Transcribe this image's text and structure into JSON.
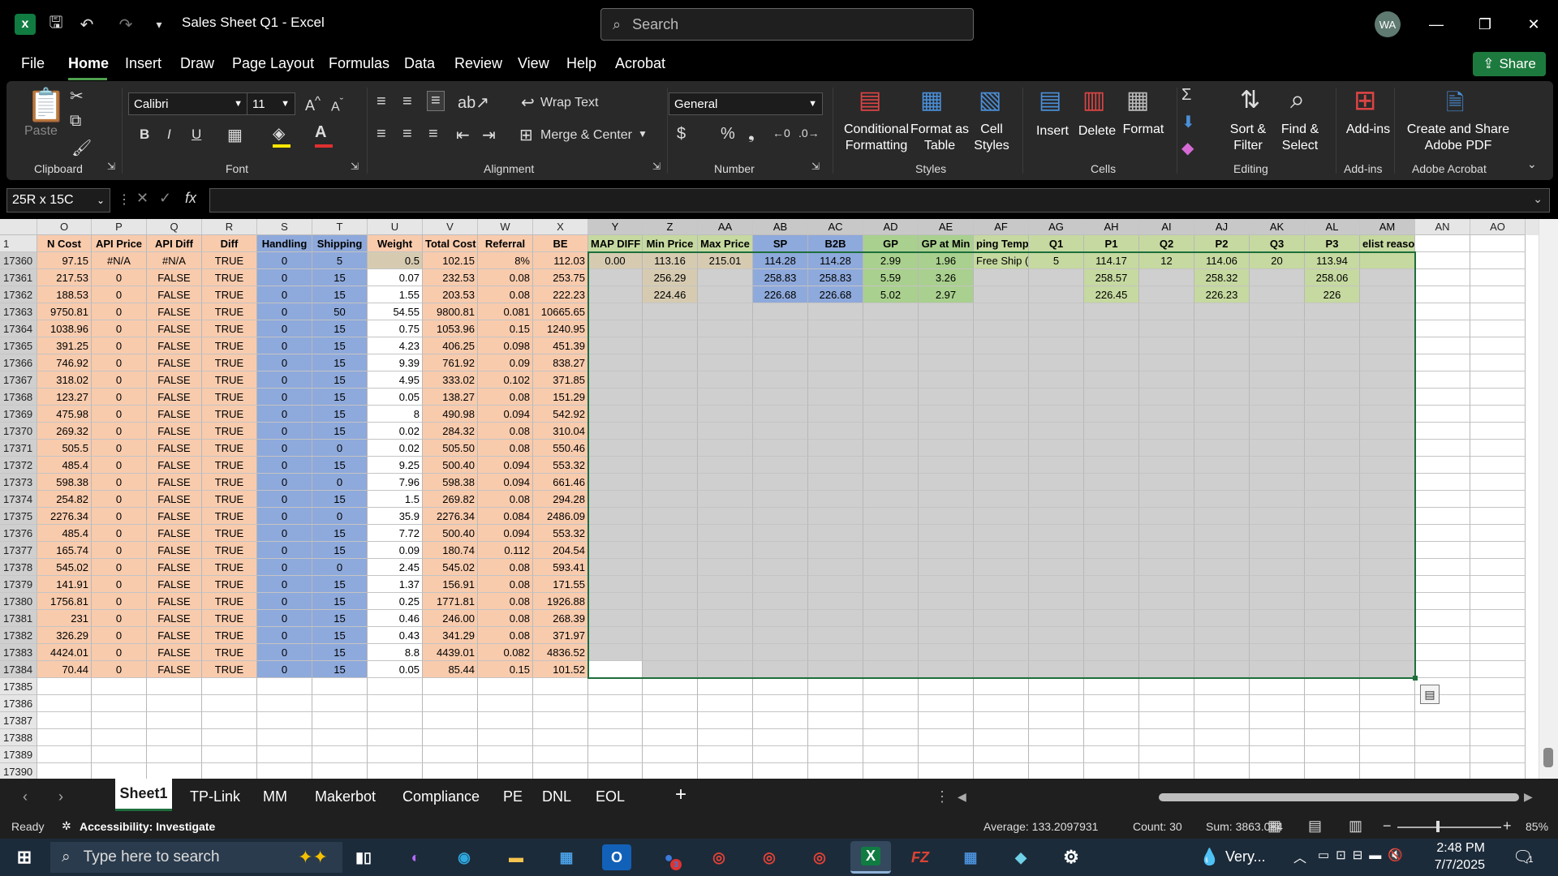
{
  "window": {
    "title": "Sales Sheet Q1  -  Excel",
    "search_placeholder": "Search",
    "user_initials": "WA",
    "app_logo": "x"
  },
  "menu": {
    "items": [
      "File",
      "Home",
      "Insert",
      "Draw",
      "Page Layout",
      "Formulas",
      "Data",
      "Review",
      "View",
      "Help",
      "Acrobat"
    ],
    "share": "Share"
  },
  "ribbon": {
    "paste": "Paste",
    "font_name": "Calibri",
    "font_size": "11",
    "bold": "B",
    "italic": "I",
    "underline": "U",
    "wrap_text": "Wrap Text",
    "merge_center": "Merge & Center",
    "number_format": "General",
    "conditional_formatting": [
      "Conditional",
      "Formatting"
    ],
    "format_as_table": [
      "Format as",
      "Table"
    ],
    "cell_styles": [
      "Cell",
      "Styles"
    ],
    "insert": "Insert",
    "delete": "Delete",
    "format": "Format",
    "sort_filter": [
      "Sort &",
      "Filter"
    ],
    "find_select": [
      "Find &",
      "Select"
    ],
    "addins": "Add-ins",
    "create_pdf": [
      "Create and Share",
      "Adobe PDF"
    ],
    "groups": [
      "Clipboard",
      "Font",
      "Alignment",
      "Number",
      "Styles",
      "Cells",
      "Editing",
      "Add-ins",
      "Adobe Acrobat"
    ]
  },
  "formula_bar": {
    "name_box": "25R x 15C",
    "fx": "fx",
    "content": ""
  },
  "columns": [
    "O",
    "P",
    "Q",
    "R",
    "S",
    "T",
    "U",
    "V",
    "W",
    "X",
    "Y",
    "Z",
    "AA",
    "AB",
    "AC",
    "AD",
    "AE",
    "AF",
    "AG",
    "AH",
    "AI",
    "AJ",
    "AK",
    "AL",
    "AM",
    "AN",
    "AO"
  ],
  "header_row": {
    "num": "1",
    "cells": [
      "N Cost",
      "API Price",
      "API Diff",
      "Diff",
      "Handling",
      "Shipping",
      "Weight",
      "Total Cost",
      "Referral",
      "BE",
      "MAP DIFF",
      "Min Price",
      "Max Price",
      "SP",
      "B2B",
      "GP",
      "GP at Min",
      "ping Temp",
      "Q1",
      "P1",
      "Q2",
      "P2",
      "Q3",
      "P3",
      "elist reason",
      "",
      ""
    ]
  },
  "rows": [
    {
      "num": "17360",
      "cells": [
        "97.15",
        "#N/A",
        "#N/A",
        "TRUE",
        "0",
        "5",
        "0.5",
        "102.15",
        "8%",
        "112.03",
        "0.00",
        "113.16",
        "215.01",
        "114.28",
        "114.28",
        "2.99",
        "1.96",
        "Free Ship (B",
        "5",
        "114.17",
        "12",
        "114.06",
        "20",
        "113.94",
        "",
        "",
        ""
      ]
    },
    {
      "num": "17361",
      "cells": [
        "217.53",
        "0",
        "FALSE",
        "TRUE",
        "0",
        "15",
        "0.07",
        "232.53",
        "0.08",
        "253.75",
        "",
        "256.29",
        "",
        "258.83",
        "258.83",
        "5.59",
        "3.26",
        "",
        "",
        "258.57",
        "",
        "258.32",
        "",
        "258.06",
        "",
        "",
        ""
      ]
    },
    {
      "num": "17362",
      "cells": [
        "188.53",
        "0",
        "FALSE",
        "TRUE",
        "0",
        "15",
        "1.55",
        "203.53",
        "0.08",
        "222.23",
        "",
        "224.46",
        "",
        "226.68",
        "226.68",
        "5.02",
        "2.97",
        "",
        "",
        "226.45",
        "",
        "226.23",
        "",
        "226",
        "",
        "",
        ""
      ]
    },
    {
      "num": "17363",
      "cells": [
        "9750.81",
        "0",
        "FALSE",
        "TRUE",
        "0",
        "50",
        "54.55",
        "9800.81",
        "0.081",
        "10665.65"
      ]
    },
    {
      "num": "17364",
      "cells": [
        "1038.96",
        "0",
        "FALSE",
        "TRUE",
        "0",
        "15",
        "0.75",
        "1053.96",
        "0.15",
        "1240.95"
      ]
    },
    {
      "num": "17365",
      "cells": [
        "391.25",
        "0",
        "FALSE",
        "TRUE",
        "0",
        "15",
        "4.23",
        "406.25",
        "0.098",
        "451.39"
      ]
    },
    {
      "num": "17366",
      "cells": [
        "746.92",
        "0",
        "FALSE",
        "TRUE",
        "0",
        "15",
        "9.39",
        "761.92",
        "0.09",
        "838.27"
      ]
    },
    {
      "num": "17367",
      "cells": [
        "318.02",
        "0",
        "FALSE",
        "TRUE",
        "0",
        "15",
        "4.95",
        "333.02",
        "0.102",
        "371.85"
      ]
    },
    {
      "num": "17368",
      "cells": [
        "123.27",
        "0",
        "FALSE",
        "TRUE",
        "0",
        "15",
        "0.05",
        "138.27",
        "0.08",
        "151.29"
      ]
    },
    {
      "num": "17369",
      "cells": [
        "475.98",
        "0",
        "FALSE",
        "TRUE",
        "0",
        "15",
        "8",
        "490.98",
        "0.094",
        "542.92"
      ]
    },
    {
      "num": "17370",
      "cells": [
        "269.32",
        "0",
        "FALSE",
        "TRUE",
        "0",
        "15",
        "0.02",
        "284.32",
        "0.08",
        "310.04"
      ]
    },
    {
      "num": "17371",
      "cells": [
        "505.5",
        "0",
        "FALSE",
        "TRUE",
        "0",
        "0",
        "0.02",
        "505.50",
        "0.08",
        "550.46"
      ]
    },
    {
      "num": "17372",
      "cells": [
        "485.4",
        "0",
        "FALSE",
        "TRUE",
        "0",
        "15",
        "9.25",
        "500.40",
        "0.094",
        "553.32"
      ]
    },
    {
      "num": "17373",
      "cells": [
        "598.38",
        "0",
        "FALSE",
        "TRUE",
        "0",
        "0",
        "7.96",
        "598.38",
        "0.094",
        "661.46"
      ]
    },
    {
      "num": "17374",
      "cells": [
        "254.82",
        "0",
        "FALSE",
        "TRUE",
        "0",
        "15",
        "1.5",
        "269.82",
        "0.08",
        "294.28"
      ]
    },
    {
      "num": "17375",
      "cells": [
        "2276.34",
        "0",
        "FALSE",
        "TRUE",
        "0",
        "0",
        "35.9",
        "2276.34",
        "0.084",
        "2486.09"
      ]
    },
    {
      "num": "17376",
      "cells": [
        "485.4",
        "0",
        "FALSE",
        "TRUE",
        "0",
        "15",
        "7.72",
        "500.40",
        "0.094",
        "553.32"
      ]
    },
    {
      "num": "17377",
      "cells": [
        "165.74",
        "0",
        "FALSE",
        "TRUE",
        "0",
        "15",
        "0.09",
        "180.74",
        "0.112",
        "204.54"
      ]
    },
    {
      "num": "17378",
      "cells": [
        "545.02",
        "0",
        "FALSE",
        "TRUE",
        "0",
        "0",
        "2.45",
        "545.02",
        "0.08",
        "593.41"
      ]
    },
    {
      "num": "17379",
      "cells": [
        "141.91",
        "0",
        "FALSE",
        "TRUE",
        "0",
        "15",
        "1.37",
        "156.91",
        "0.08",
        "171.55"
      ]
    },
    {
      "num": "17380",
      "cells": [
        "1756.81",
        "0",
        "FALSE",
        "TRUE",
        "0",
        "15",
        "0.25",
        "1771.81",
        "0.08",
        "1926.88"
      ]
    },
    {
      "num": "17381",
      "cells": [
        "231",
        "0",
        "FALSE",
        "TRUE",
        "0",
        "15",
        "0.46",
        "246.00",
        "0.08",
        "268.39"
      ]
    },
    {
      "num": "17382",
      "cells": [
        "326.29",
        "0",
        "FALSE",
        "TRUE",
        "0",
        "15",
        "0.43",
        "341.29",
        "0.08",
        "371.97"
      ]
    },
    {
      "num": "17383",
      "cells": [
        "4424.01",
        "0",
        "FALSE",
        "TRUE",
        "0",
        "15",
        "8.8",
        "4439.01",
        "0.082",
        "4836.52"
      ]
    },
    {
      "num": "17384",
      "cells": [
        "70.44",
        "0",
        "FALSE",
        "TRUE",
        "0",
        "15",
        "0.05",
        "85.44",
        "0.15",
        "101.52"
      ]
    }
  ],
  "empty_rows": [
    "17385",
    "17386",
    "17387",
    "17388",
    "17389",
    "17390"
  ],
  "sheets": [
    "Sheet1",
    "TP-Link",
    "MM",
    "Makerbot",
    "Compliance",
    "PE",
    "DNL",
    "EOL"
  ],
  "status": {
    "ready": "Ready",
    "accessibility": "Accessibility: Investigate",
    "average": "Average: 133.2097931",
    "count": "Count: 30",
    "sum": "Sum: 3863.084",
    "zoom": "85%"
  },
  "taskbar": {
    "search": "Type here to search",
    "weather": "Very...",
    "time": "2:48 PM",
    "date": "7/7/2025",
    "notif": "1",
    "outlook_badge": "3"
  },
  "colors": {
    "orange": "#f8cbad",
    "blue": "#8ea9db",
    "tan": "#d6cbb1",
    "green": "#a9d08e",
    "olive": "#c6d9a0",
    "selection": "#cfcfcf",
    "excel_green": "#107c41"
  }
}
